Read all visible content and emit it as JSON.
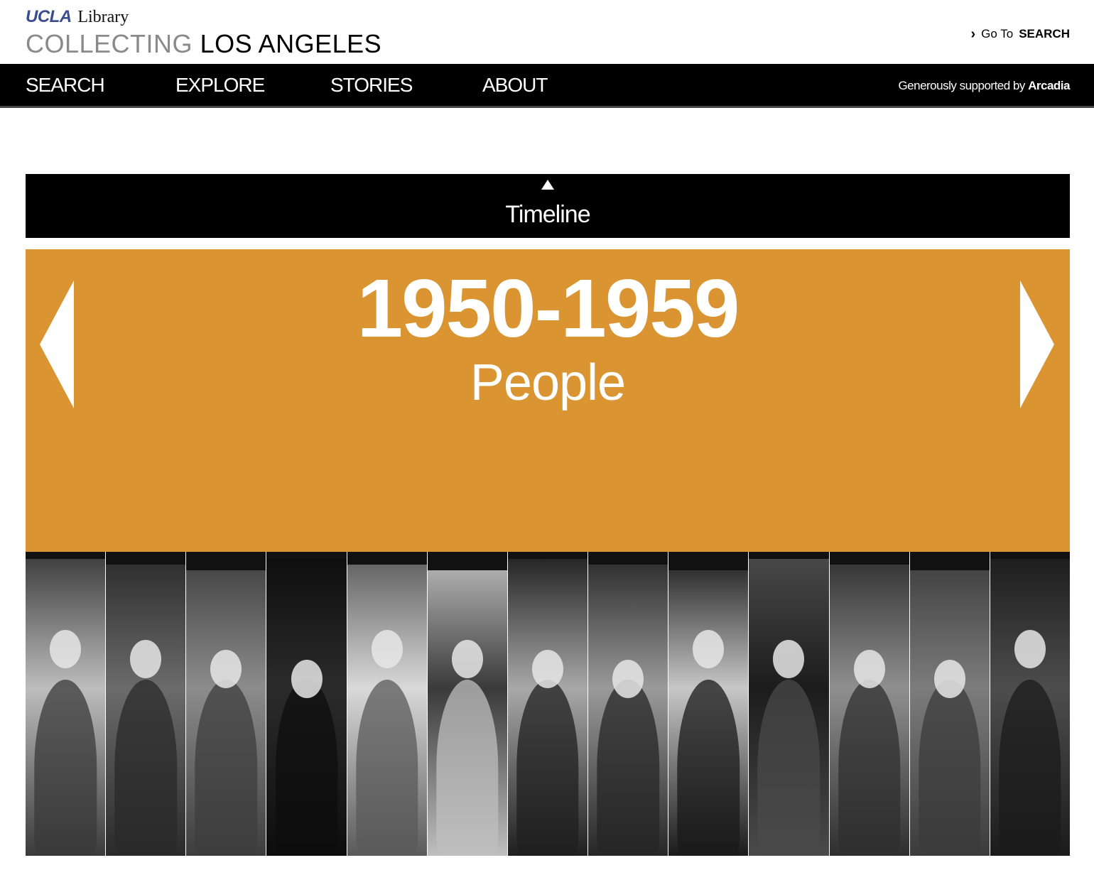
{
  "header": {
    "brand_ucla": "UCLA",
    "brand_library": "Library",
    "brand_collecting": "COLLECTING",
    "brand_la": "LOS ANGELES",
    "goto_prefix": "Go To",
    "goto_target": "SEARCH"
  },
  "nav": {
    "items": [
      "SEARCH",
      "EXPLORE",
      "STORIES",
      "ABOUT"
    ],
    "support_prefix": "Generously supported by",
    "support_name": "Arcadia"
  },
  "timeline": {
    "label": "Timeline"
  },
  "panel": {
    "period": "1950-1959",
    "category": "People",
    "accent_color": "#da9432"
  },
  "photos": [
    {
      "tone": "#bdbdbd",
      "dark": "#3a3a3a"
    },
    {
      "tone": "#6b6b6b",
      "dark": "#2a2a2a"
    },
    {
      "tone": "#8c8c8c",
      "dark": "#3d3d3d"
    },
    {
      "tone": "#2b2b2b",
      "dark": "#0d0d0d"
    },
    {
      "tone": "#d9d9d9",
      "dark": "#5a5a5a"
    },
    {
      "tone": "#3a3a3a",
      "dark": "#bfbfbf"
    },
    {
      "tone": "#a8a8a8",
      "dark": "#1f1f1f"
    },
    {
      "tone": "#9a9a9a",
      "dark": "#262626"
    },
    {
      "tone": "#c7c7c7",
      "dark": "#1a1a1a"
    },
    {
      "tone": "#1c1c1c",
      "dark": "#4a4a4a"
    },
    {
      "tone": "#8f8f8f",
      "dark": "#2f2f2f"
    },
    {
      "tone": "#7c7c7c",
      "dark": "#3b3b3b"
    },
    {
      "tone": "#4d4d4d",
      "dark": "#1b1b1b"
    }
  ]
}
